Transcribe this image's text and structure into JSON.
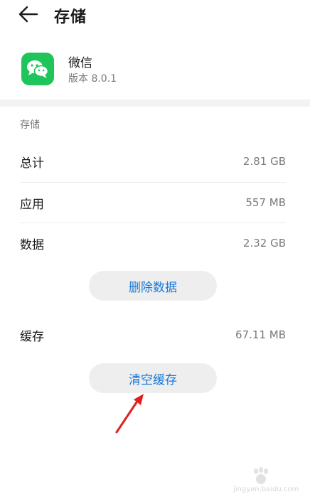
{
  "header": {
    "title": "存储"
  },
  "app": {
    "name": "微信",
    "version": "版本 8.0.1"
  },
  "storage": {
    "section_label": "存储",
    "rows": [
      {
        "label": "总计",
        "value": "2.81 GB"
      },
      {
        "label": "应用",
        "value": "557 MB"
      },
      {
        "label": "数据",
        "value": "2.32 GB"
      }
    ],
    "delete_data_label": "删除数据"
  },
  "cache": {
    "label": "缓存",
    "value": "67.11 MB",
    "clear_label": "清空缓存"
  },
  "watermark": {
    "text": "jingyan.baidu.com"
  },
  "colors": {
    "accent": "#1677d8",
    "app_icon_bg": "#1fc45a",
    "annotation_arrow": "#e02020"
  }
}
